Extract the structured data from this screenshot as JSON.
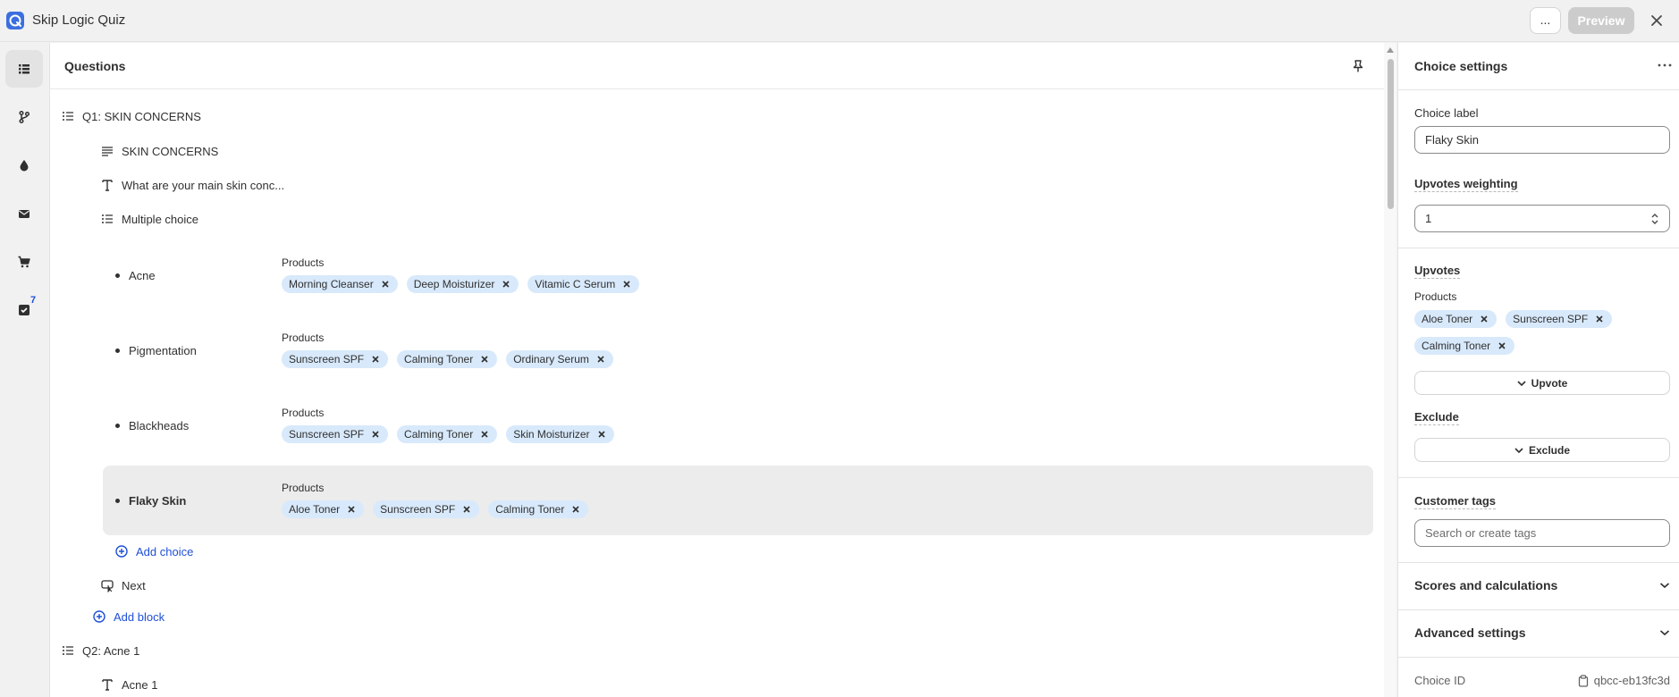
{
  "app": {
    "title": "Skip Logic Quiz",
    "more_label": "...",
    "preview_label": "Preview"
  },
  "rail": {
    "badge_count": "7"
  },
  "questions": {
    "title": "Questions",
    "q1": {
      "label": "Q1: SKIN CONCERNS",
      "heading": "SKIN CONCERNS",
      "text": "What are your main skin conc...",
      "type": "Multiple choice",
      "choices": [
        {
          "name": "Acne",
          "products_label": "Products",
          "products": [
            "Morning Cleanser",
            "Deep Moisturizer",
            "Vitamic C Serum"
          ]
        },
        {
          "name": "Pigmentation",
          "products_label": "Products",
          "products": [
            "Sunscreen SPF",
            "Calming Toner",
            "Ordinary Serum"
          ]
        },
        {
          "name": "Blackheads",
          "products_label": "Products",
          "products": [
            "Sunscreen SPF",
            "Calming Toner",
            "Skin Moisturizer"
          ]
        },
        {
          "name": "Flaky Skin",
          "products_label": "Products",
          "products": [
            "Aloe Toner",
            "Sunscreen SPF",
            "Calming Toner"
          ]
        }
      ],
      "add_choice": "Add choice",
      "next": "Next",
      "add_block": "Add block"
    },
    "q2": {
      "label": "Q2: Acne 1",
      "text": "Acne 1"
    }
  },
  "side": {
    "title": "Choice settings",
    "choice_label_title": "Choice label",
    "choice_label_value": "Flaky Skin",
    "upvotes_weighting_title": "Upvotes weighting",
    "upvotes_weighting_value": "1",
    "upvotes_title": "Upvotes",
    "upvotes_products_label": "Products",
    "upvotes_products": [
      "Aloe Toner",
      "Sunscreen SPF",
      "Calming Toner"
    ],
    "upvote_button": "Upvote",
    "exclude_title": "Exclude",
    "exclude_button": "Exclude",
    "customer_tags_title": "Customer tags",
    "customer_tags_placeholder": "Search or create tags",
    "scores_title": "Scores and calculations",
    "advanced_title": "Advanced settings",
    "choice_id_label": "Choice ID",
    "choice_id_value": "qbcc-eb13fc3d"
  },
  "colors": {
    "accent": "#1e4fd6",
    "tag_bg": "#d8e9fb",
    "selected_row": "#ececec"
  }
}
